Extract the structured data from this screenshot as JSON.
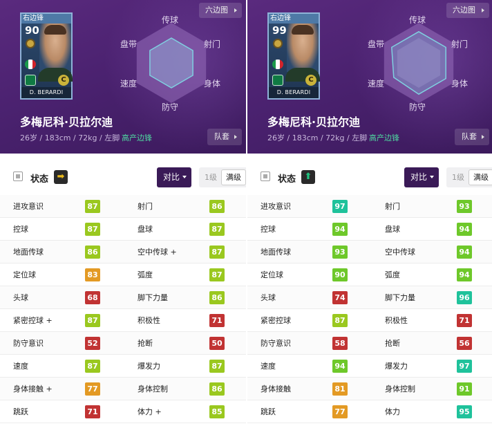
{
  "colors": {
    "teal": "#1fc29b",
    "green": "#6ec82a",
    "lime": "#9ac81f",
    "orange": "#e39a24",
    "red": "#c13333",
    "up_arrow": "#20c27f",
    "right_arrow": "#e8b81a"
  },
  "panels": [
    {
      "card": {
        "position": "右边锋",
        "rating": "90",
        "name": "D. BERARDI",
        "grade": "C"
      },
      "hex_button": "六边图",
      "radar_labels": {
        "top": "传球",
        "upper_left": "盘带",
        "upper_right": "射门",
        "lower_left": "速度",
        "lower_right": "身体",
        "bottom": "防守"
      },
      "radar_levels": [
        0.62,
        0.62,
        0.62,
        0.62,
        0.62,
        0.62
      ],
      "player_name": "多梅尼科·贝拉尔迪",
      "player_info": "26岁 / 183cm / 72kg / 左脚",
      "player_tag": "高产边锋",
      "team_button": "队套",
      "status_label": "状态",
      "status_arrow": "➡",
      "status_arrow_color": "#e8b81a",
      "compare_button": "对比",
      "level_1": "1级",
      "level_max": "满级",
      "stats": [
        {
          "n1": "进攻意识",
          "v1": "87",
          "c1": "lime",
          "n2": "射门",
          "v2": "86",
          "c2": "lime"
        },
        {
          "n1": "控球",
          "v1": "87",
          "c1": "lime",
          "n2": "盘球",
          "v2": "87",
          "c2": "lime"
        },
        {
          "n1": "地面传球",
          "v1": "86",
          "c1": "lime",
          "n2": "空中传球 +",
          "v2": "87",
          "c2": "lime"
        },
        {
          "n1": "定位球",
          "v1": "83",
          "c1": "orange",
          "n2": "弧度",
          "v2": "87",
          "c2": "lime"
        },
        {
          "n1": "头球",
          "v1": "68",
          "c1": "red",
          "n2": "脚下力量",
          "v2": "86",
          "c2": "lime"
        },
        {
          "n1": "紧密控球 +",
          "v1": "87",
          "c1": "lime",
          "n2": "积极性",
          "v2": "71",
          "c2": "red"
        },
        {
          "n1": "防守意识",
          "v1": "52",
          "c1": "red",
          "n2": "抢断",
          "v2": "50",
          "c2": "red"
        },
        {
          "n1": "速度",
          "v1": "87",
          "c1": "lime",
          "n2": "爆发力",
          "v2": "87",
          "c2": "lime"
        },
        {
          "n1": "身体接触 +",
          "v1": "77",
          "c1": "orange",
          "n2": "身体控制",
          "v2": "86",
          "c2": "lime"
        },
        {
          "n1": "跳跃",
          "v1": "71",
          "c1": "red",
          "n2": "体力 +",
          "v2": "85",
          "c2": "lime"
        }
      ]
    },
    {
      "card": {
        "position": "右边锋",
        "rating": "99",
        "name": "D. BERARDI",
        "grade": "C"
      },
      "hex_button": "六边图",
      "radar_labels": {
        "top": "传球",
        "upper_left": "盘带",
        "upper_right": "射门",
        "lower_left": "速度",
        "lower_right": "身体",
        "bottom": "防守"
      },
      "radar_levels": [
        0.78,
        0.78,
        0.78,
        0.78,
        0.72,
        0.78
      ],
      "player_name": "多梅尼科·贝拉尔迪",
      "player_info": "26岁 / 183cm / 72kg / 左脚",
      "player_tag": "高产边锋",
      "team_button": "队套",
      "status_label": "状态",
      "status_arrow": "⬆",
      "status_arrow_color": "#20c27f",
      "compare_button": "对比",
      "level_1": "1级",
      "level_max": "满级",
      "stats": [
        {
          "n1": "进攻意识",
          "v1": "97",
          "c1": "teal",
          "n2": "射门",
          "v2": "93",
          "c2": "green"
        },
        {
          "n1": "控球",
          "v1": "94",
          "c1": "green",
          "n2": "盘球",
          "v2": "94",
          "c2": "green"
        },
        {
          "n1": "地面传球",
          "v1": "93",
          "c1": "green",
          "n2": "空中传球",
          "v2": "94",
          "c2": "green"
        },
        {
          "n1": "定位球",
          "v1": "90",
          "c1": "green",
          "n2": "弧度",
          "v2": "94",
          "c2": "green"
        },
        {
          "n1": "头球",
          "v1": "74",
          "c1": "red",
          "n2": "脚下力量",
          "v2": "96",
          "c2": "teal"
        },
        {
          "n1": "紧密控球",
          "v1": "87",
          "c1": "lime",
          "n2": "积极性",
          "v2": "71",
          "c2": "red"
        },
        {
          "n1": "防守意识",
          "v1": "58",
          "c1": "red",
          "n2": "抢断",
          "v2": "56",
          "c2": "red"
        },
        {
          "n1": "速度",
          "v1": "94",
          "c1": "green",
          "n2": "爆发力",
          "v2": "97",
          "c2": "teal"
        },
        {
          "n1": "身体接触",
          "v1": "81",
          "c1": "orange",
          "n2": "身体控制",
          "v2": "91",
          "c2": "green"
        },
        {
          "n1": "跳跃",
          "v1": "77",
          "c1": "orange",
          "n2": "体力",
          "v2": "95",
          "c2": "teal"
        }
      ]
    }
  ]
}
